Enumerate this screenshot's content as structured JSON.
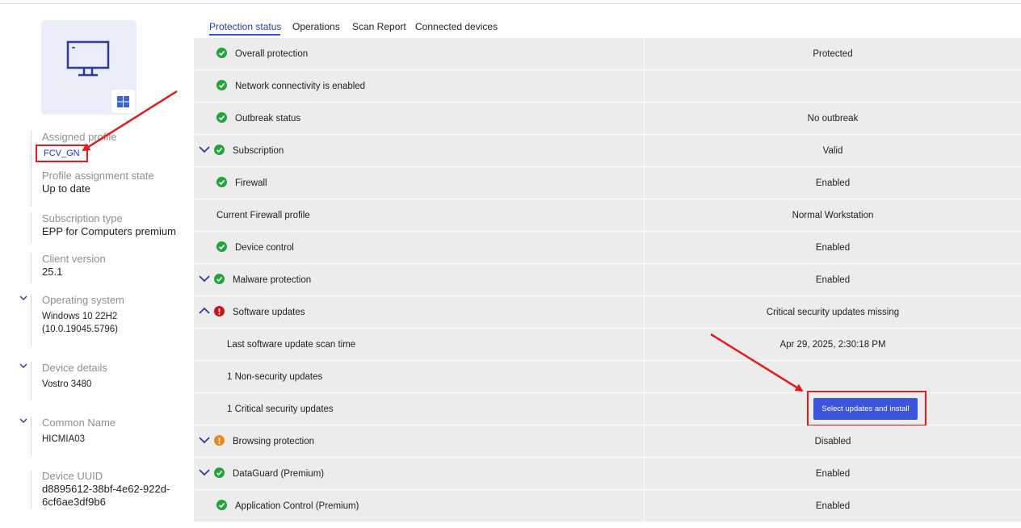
{
  "tabs": [
    "Protection status",
    "Operations",
    "Scan Report",
    "Connected devices"
  ],
  "device": {
    "monitor_icon": "monitor-icon",
    "os_icon": "windows-icon",
    "assigned_profile_label": "Assigned profile",
    "assigned_profile_value": "FCV_GN",
    "profile_state_label": "Profile assignment state",
    "profile_state_value": "Up to date",
    "subscription_label": "Subscription type",
    "subscription_value": "EPP for Computers premium",
    "client_version_label": "Client version",
    "client_version_value": "25.1",
    "os_label": "Operating system",
    "os_value_1": "Windows 10 22H2",
    "os_value_2": "(10.0.19045.5796)",
    "device_details_label": "Device details",
    "device_details_value": "Vostro 3480",
    "common_name_label": "Common Name",
    "common_name_value": "HICMIA03",
    "uuid_label": "Device UUID",
    "uuid_value_1": "d8895612-38bf-4e62-922d-",
    "uuid_value_2": "6cf6ae3df9b6"
  },
  "protection": [
    {
      "label": "Overall protection",
      "value": "Protected",
      "status": "ok"
    },
    {
      "label": "Network connectivity is enabled",
      "value": "",
      "status": "ok"
    },
    {
      "label": "Outbreak status",
      "value": "No outbreak",
      "status": "ok"
    },
    {
      "label": "Subscription",
      "value": "Valid",
      "status": "ok",
      "expand": "collapsed"
    },
    {
      "label": "Firewall",
      "value": "Enabled",
      "status": "ok"
    },
    {
      "label": "Current Firewall profile",
      "value": "Normal Workstation",
      "status": "none"
    },
    {
      "label": "Device control",
      "value": "Enabled",
      "status": "ok"
    },
    {
      "label": "Malware protection",
      "value": "Enabled",
      "status": "ok",
      "expand": "collapsed"
    },
    {
      "label": "Software updates",
      "value": "Critical security updates missing",
      "status": "critical",
      "expand": "expanded"
    },
    {
      "label": "Last software update scan time",
      "value": "Apr 29, 2025, 2:30:18 PM",
      "status": "sub"
    },
    {
      "label": "1 Non-security updates",
      "value": "",
      "status": "sub"
    },
    {
      "label": "1 Critical security updates",
      "value": "",
      "status": "sub",
      "button": "Select updates and install"
    },
    {
      "label": "Browsing protection",
      "value": "Disabled",
      "status": "warning",
      "expand": "collapsed"
    },
    {
      "label": "DataGuard (Premium)",
      "value": "Enabled",
      "status": "ok",
      "expand": "collapsed"
    },
    {
      "label": "Application Control (Premium)",
      "value": "Enabled",
      "status": "ok"
    }
  ],
  "colors": {
    "ok": "#1fa33a",
    "critical": "#c4151c",
    "warning": "#e8871e",
    "accent": "#3d55dd",
    "annotation": "#e41b1b"
  }
}
